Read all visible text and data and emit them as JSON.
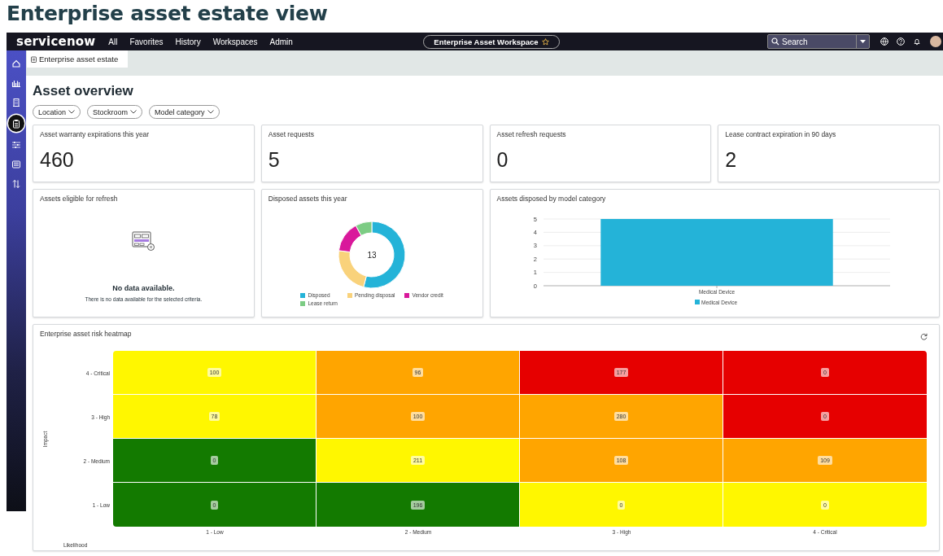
{
  "page_heading": "Enterprise asset estate view",
  "nav": {
    "logo": "servicenow",
    "menu": [
      "All",
      "Favorites",
      "History",
      "Workspaces",
      "Admin"
    ],
    "workspace": "Enterprise Asset Workspace",
    "search": {
      "placeholder": "Search"
    }
  },
  "sidebar": {
    "items": [
      {
        "selected": false
      },
      {
        "selected": false
      },
      {
        "selected": false
      },
      {
        "selected": true
      },
      {
        "selected": false
      },
      {
        "selected": false
      },
      {
        "selected": false
      }
    ]
  },
  "tab": {
    "label": "Enterprise asset estate"
  },
  "title": "Asset overview",
  "filters": [
    "Location",
    "Stockroom",
    "Model category"
  ],
  "kpis": [
    {
      "title": "Asset warranty expirations this year",
      "value": "460"
    },
    {
      "title": "Asset requests",
      "value": "5"
    },
    {
      "title": "Asset refresh requests",
      "value": "0"
    },
    {
      "title": "Lease contract expiration in 90 days",
      "value": "2"
    }
  ],
  "eligible": {
    "title": "Assets eligible for refresh",
    "message": "No data available.",
    "detail": "There is no data available for the selected criteria."
  },
  "disposed": {
    "title": "Disposed assets this year",
    "total": "13",
    "legend": [
      {
        "label": "Disposed",
        "color": "#24b3d8"
      },
      {
        "label": "Pending disposal",
        "color": "#f9d27b"
      },
      {
        "label": "Vendor credit",
        "color": "#d9189b"
      },
      {
        "label": "Lease return",
        "color": "#7ccc84"
      }
    ]
  },
  "by_model": {
    "title": "Assets disposed by model category",
    "chart_data": {
      "type": "bar",
      "categories": [
        "Medical Device"
      ],
      "series": [
        {
          "name": "Medical Device",
          "color": "#24b3d8",
          "values": [
            5
          ]
        }
      ],
      "grid": true,
      "ylim": [
        0,
        5
      ],
      "yticks": [
        0,
        1,
        2,
        3,
        4,
        5
      ]
    }
  },
  "heatmap": {
    "title": "Enterprise asset risk heatmap",
    "ylabel": "Impact",
    "rows": [
      {
        "label": "4 - Critical",
        "cells": [
          {
            "value": "100",
            "color": "#fff700"
          },
          {
            "value": "96",
            "color": "#ffa500"
          },
          {
            "value": "177",
            "color": "#e60000"
          },
          {
            "value": "0",
            "color": "#e60000"
          }
        ]
      },
      {
        "label": "3 - High",
        "cells": [
          {
            "value": "78",
            "color": "#fff700"
          },
          {
            "value": "100",
            "color": "#ffa500"
          },
          {
            "value": "280",
            "color": "#ffa500"
          },
          {
            "value": "0",
            "color": "#e60000"
          }
        ]
      },
      {
        "label": "2 - Medium",
        "cells": [
          {
            "value": "0",
            "color": "#137a00"
          },
          {
            "value": "211",
            "color": "#fff700"
          },
          {
            "value": "108",
            "color": "#ffa500"
          },
          {
            "value": "109",
            "color": "#ffa500"
          }
        ]
      },
      {
        "label": "1 - Low",
        "cells": [
          {
            "value": "0",
            "color": "#137a00"
          },
          {
            "value": "196",
            "color": "#137a00"
          },
          {
            "value": "0",
            "color": "#fff700"
          },
          {
            "value": "0",
            "color": "#fff700"
          }
        ]
      }
    ],
    "x_axis_labels": [
      "1 - Low",
      "2 - Medium",
      "3 - High",
      "4 - Critical"
    ],
    "xlabel": "Likelihood"
  }
}
